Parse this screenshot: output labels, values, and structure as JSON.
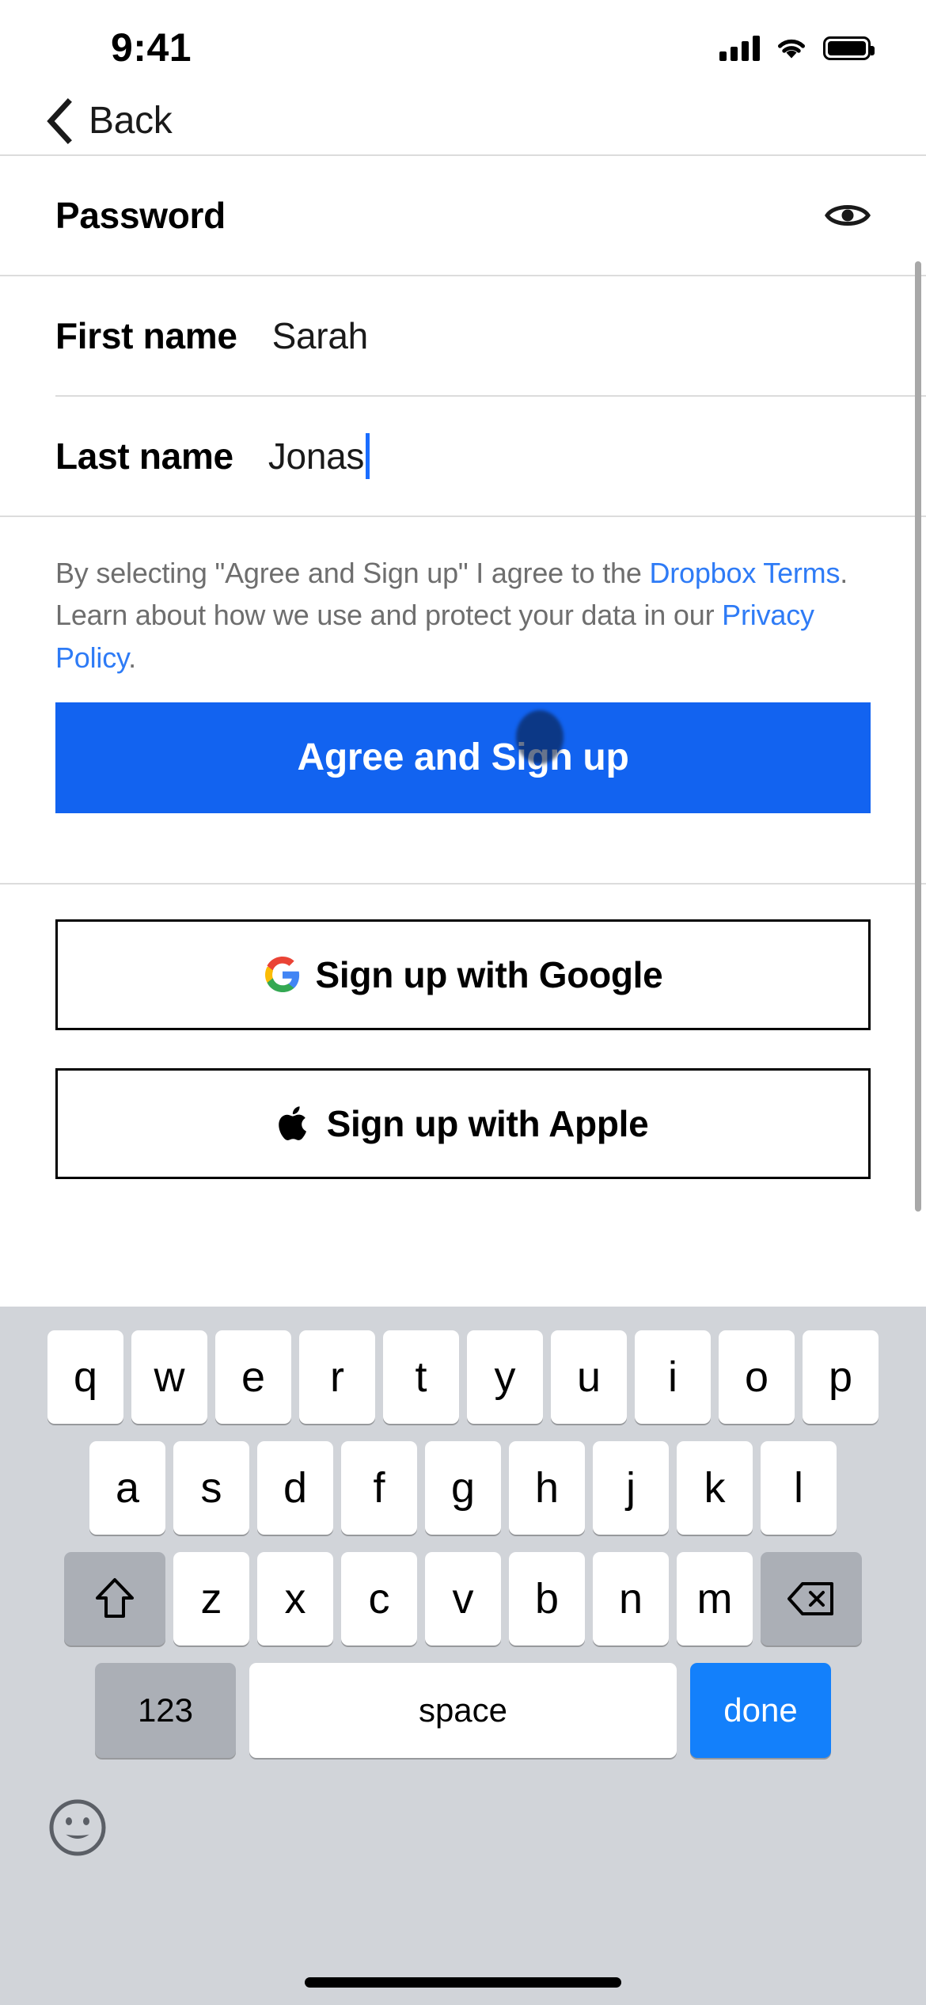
{
  "status_bar": {
    "time": "9:41",
    "cellular_icon": "cellular-bars-icon",
    "wifi_icon": "wifi-icon",
    "battery_icon": "battery-full-icon"
  },
  "nav": {
    "back_label": "Back",
    "back_icon": "chevron-left-icon"
  },
  "form": {
    "password": {
      "label": "Password",
      "reveal_icon": "eye-icon"
    },
    "first_name": {
      "label": "First name",
      "value": "Sarah"
    },
    "last_name": {
      "label": "Last name",
      "value": "Jonas"
    }
  },
  "legal": {
    "part1": "By selecting \"Agree and Sign up\" I agree to the ",
    "link1": "Dropbox Terms",
    "part2": ". Learn about how we use and protect your data in our ",
    "link2": "Privacy Policy",
    "part3": ".",
    "link_color": "#2e7bf6"
  },
  "primary_button": {
    "label": "Agree and Sign up",
    "color": "#1263f0"
  },
  "social_buttons": [
    {
      "label": "Sign up with Google",
      "icon": "google-g-icon"
    },
    {
      "label": "Sign up with Apple",
      "icon": "apple-logo-icon"
    }
  ],
  "keyboard": {
    "row1": [
      "q",
      "w",
      "e",
      "r",
      "t",
      "y",
      "u",
      "i",
      "o",
      "p"
    ],
    "row2": [
      "a",
      "s",
      "d",
      "f",
      "g",
      "h",
      "j",
      "k",
      "l"
    ],
    "row3": [
      "z",
      "x",
      "c",
      "v",
      "b",
      "n",
      "m"
    ],
    "shift_icon": "shift-arrow-icon",
    "backspace_icon": "backspace-delete-icon",
    "numeric_label": "123",
    "space_label": "space",
    "done_label": "done",
    "emoji_icon": "emoji-smiley-icon",
    "done_color": "#1380fb"
  }
}
